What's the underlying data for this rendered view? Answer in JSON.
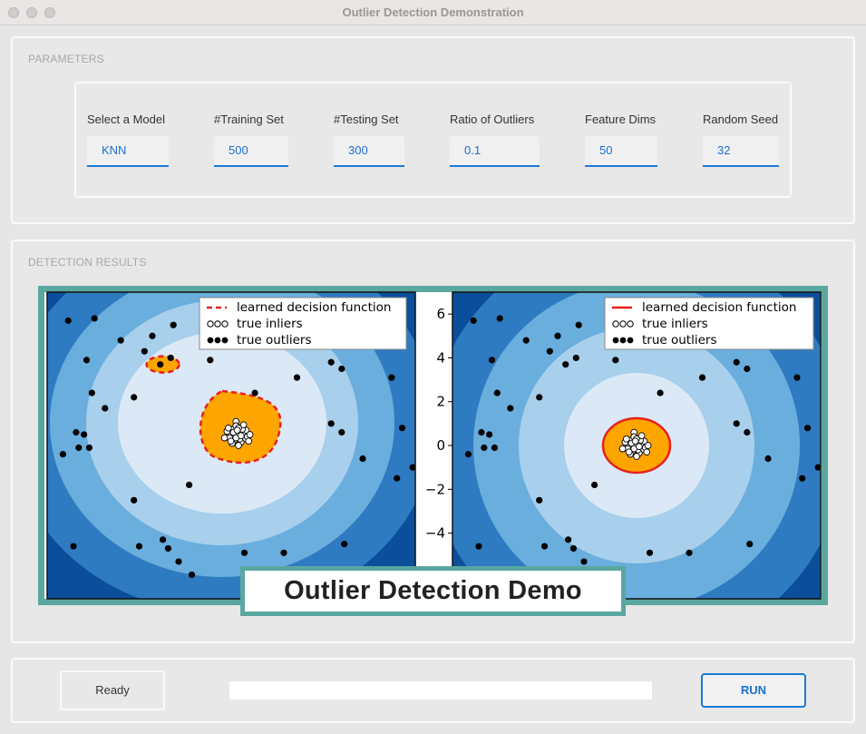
{
  "window": {
    "title": "Outlier Detection Demonstration"
  },
  "parameters": {
    "group_title": "PARAMETERS",
    "fields": [
      {
        "label": "Select a Model",
        "value": "KNN"
      },
      {
        "label": "#Training Set",
        "value": "500"
      },
      {
        "label": "#Testing Set",
        "value": "300"
      },
      {
        "label": "Ratio of Outliers",
        "value": "0.1"
      },
      {
        "label": "Feature Dims",
        "value": "50"
      },
      {
        "label": "Random Seed",
        "value": "32"
      }
    ]
  },
  "results": {
    "group_title": "DETECTION RESULTS",
    "banner": "Outlier Detection Demo"
  },
  "chart_data": {
    "type": "scatter",
    "y_ticks": [
      "6",
      "4",
      "2",
      "0",
      "−2",
      "−4"
    ],
    "ylim": [
      -7,
      7
    ],
    "xlim": [
      -7,
      7
    ],
    "panels": [
      {
        "legend": [
          "learned decision function",
          "true inliers",
          "true outliers"
        ],
        "boundary_style": "dashed"
      },
      {
        "legend": [
          "learned decision function",
          "true inliers",
          "true outliers"
        ],
        "boundary_style": "solid"
      }
    ],
    "outliers": [
      [
        -6.2,
        5.7
      ],
      [
        -5.2,
        5.8
      ],
      [
        -4.2,
        4.8
      ],
      [
        -3.0,
        5.0
      ],
      [
        -2.3,
        4.0
      ],
      [
        -2.7,
        3.7
      ],
      [
        -3.7,
        2.2
      ],
      [
        -5.5,
        3.9
      ],
      [
        -5.3,
        2.4
      ],
      [
        -4.8,
        1.7
      ],
      [
        -5.6,
        0.5
      ],
      [
        -5.9,
        0.6
      ],
      [
        -5.8,
        -0.1
      ],
      [
        -6.4,
        -0.4
      ],
      [
        -5.4,
        -0.1
      ],
      [
        -3.7,
        -2.5
      ],
      [
        -3.5,
        -4.6
      ],
      [
        -6.0,
        -4.6
      ],
      [
        -2.4,
        -4.7
      ],
      [
        -2.0,
        -5.3
      ],
      [
        -1.5,
        -5.9
      ],
      [
        -0.8,
        3.9
      ],
      [
        0.9,
        2.4
      ],
      [
        2.5,
        3.1
      ],
      [
        3.8,
        3.8
      ],
      [
        4.2,
        3.5
      ],
      [
        3.8,
        1.0
      ],
      [
        4.2,
        0.6
      ],
      [
        5.0,
        -0.6
      ],
      [
        6.5,
        0.8
      ],
      [
        6.1,
        3.1
      ],
      [
        6.3,
        -1.5
      ],
      [
        6.9,
        -1.0
      ],
      [
        4.3,
        -4.5
      ],
      [
        2.0,
        -4.9
      ],
      [
        0.5,
        -4.9
      ],
      [
        -1.6,
        -1.8
      ],
      [
        -2.6,
        -4.3
      ],
      [
        -3.3,
        4.3
      ],
      [
        -2.2,
        5.5
      ]
    ],
    "inliers": [
      [
        -0.2,
        1.2
      ],
      [
        0.3,
        0.7
      ],
      [
        -0.4,
        0.5
      ],
      [
        0.1,
        0.2
      ],
      [
        0.5,
        0.1
      ],
      [
        -0.6,
        0.0
      ],
      [
        -0.1,
        -0.1
      ],
      [
        0.4,
        -0.4
      ],
      [
        -0.3,
        -0.5
      ],
      [
        0.2,
        -0.7
      ],
      [
        -0.7,
        -0.3
      ],
      [
        0.7,
        -0.2
      ],
      [
        0.0,
        -1.0
      ],
      [
        -0.5,
        -0.8
      ],
      [
        0.6,
        0.4
      ],
      [
        -0.2,
        0.8
      ],
      [
        0.3,
        0.5
      ],
      [
        -0.9,
        0.3
      ],
      [
        0.9,
        0.0
      ],
      [
        -0.4,
        0.2
      ],
      [
        0.1,
        -0.4
      ],
      [
        0.0,
        0.6
      ],
      [
        -1.1,
        -0.3
      ],
      [
        0.8,
        -0.6
      ],
      [
        -0.2,
        -0.3
      ],
      [
        0.4,
        0.9
      ],
      [
        -0.8,
        0.6
      ],
      [
        -0.1,
        0.4
      ],
      [
        0.2,
        -0.1
      ],
      [
        -0.6,
        -0.6
      ]
    ],
    "colors": {
      "background": "#ffffff",
      "levels": [
        "#0b4f9c",
        "#2f7bc1",
        "#6aaede",
        "#a8cfec",
        "#dbe9f6"
      ],
      "inlier_region": "#ffa500",
      "boundary": "#e8201f",
      "outlier": "#000000",
      "inlier": "#ffffff"
    }
  },
  "footer": {
    "status": "Ready",
    "progress": 0,
    "run_label": "RUN"
  }
}
